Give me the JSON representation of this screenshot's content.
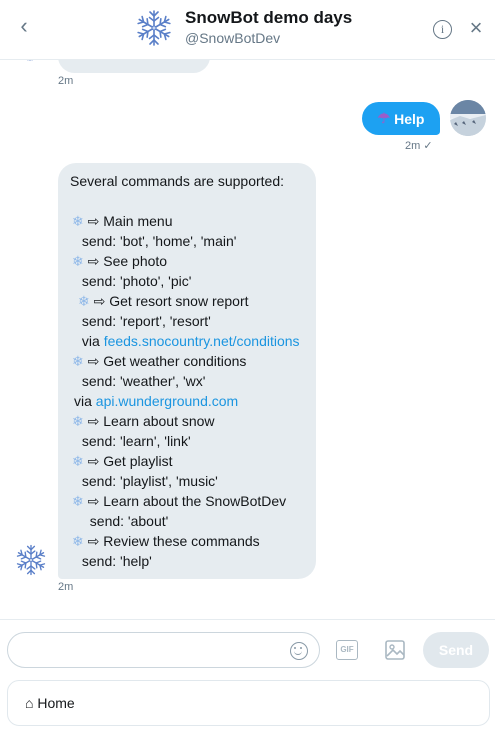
{
  "header": {
    "title": "SnowBot demo days",
    "handle": "@SnowBotDev",
    "back_icon": "chevron-left-icon",
    "info_icon": "info-icon",
    "close_icon": "close-icon"
  },
  "thread": {
    "prev_timestamp": "2m",
    "outgoing": {
      "text": "Help",
      "emoji": "☂",
      "timestamp": "2m",
      "read_mark": "✓"
    },
    "incoming": {
      "timestamp": "2m",
      "lines": [
        {
          "flake": "",
          "text": "Several commands are supported:"
        },
        {
          "flake": "❄",
          "text": " ⇨ Main menu"
        },
        {
          "flake": "",
          "text": " send: 'bot', 'home', 'main'"
        },
        {
          "flake": "❄",
          "text": " ⇨ See photo"
        },
        {
          "flake": "",
          "text": " send: 'photo', 'pic'"
        },
        {
          "flake": "❄",
          "text": " ⇨ Get resort snow report"
        },
        {
          "flake": "",
          "text": " send: 'report', 'resort'"
        },
        {
          "flake": "",
          "text": " via ",
          "link": "feeds.snocountry.net/conditions"
        },
        {
          "flake": "❄",
          "text": " ⇨ Get weather conditions"
        },
        {
          "flake": "",
          "text": " send: 'weather', 'wx'"
        },
        {
          "flake": "",
          "text": "via ",
          "link": "api.wunderground.com"
        },
        {
          "flake": "❄",
          "text": " ⇨ Learn about snow"
        },
        {
          "flake": "",
          "text": " send: 'learn', 'link'"
        },
        {
          "flake": "❄",
          "text": " ⇨ Get playlist"
        },
        {
          "flake": "",
          "text": " send: 'playlist', 'music'"
        },
        {
          "flake": "❄",
          "text": " ⇨ Learn about the SnowBotDev"
        },
        {
          "flake": "",
          "text": "  send: 'about'"
        },
        {
          "flake": "❄",
          "text": " ⇨ Review these commands"
        },
        {
          "flake": "",
          "text": " send: 'help'"
        }
      ]
    }
  },
  "composer": {
    "placeholder": "",
    "gif_label": "GIF",
    "send_label": "Send",
    "emoji_icon": "emoji-icon",
    "image_icon": "image-icon"
  },
  "quick_reply": {
    "label": "⌂ Home"
  },
  "colors": {
    "accent": "#1da1f2",
    "link": "#1b95e0",
    "bubble_in": "#e6ecf0",
    "muted": "#657786"
  }
}
